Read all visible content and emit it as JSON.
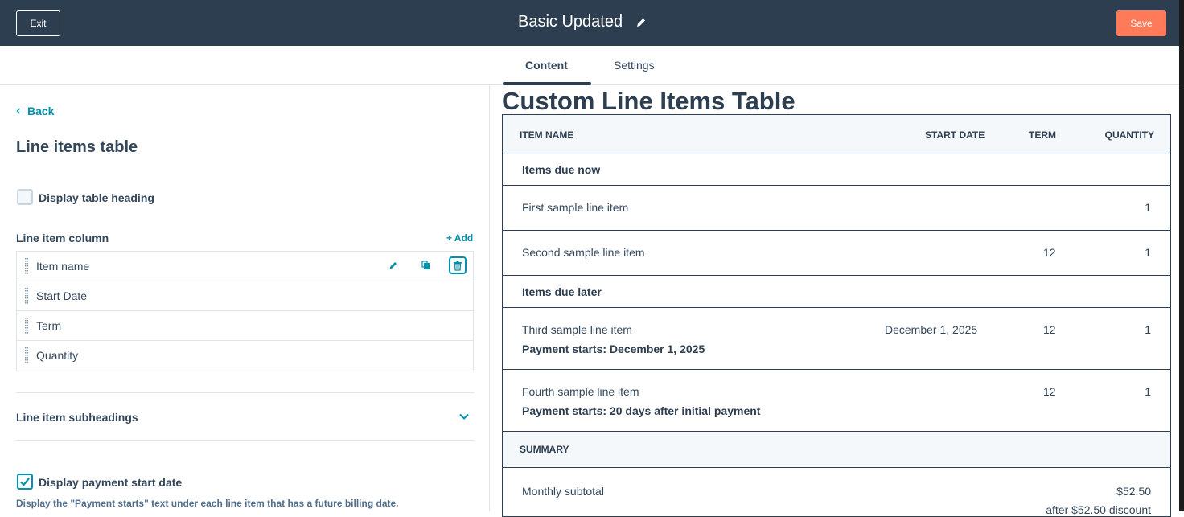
{
  "topbar": {
    "exit_label": "Exit",
    "title": "Basic Updated",
    "save_label": "Save",
    "colors": {
      "bg": "#2d3e50",
      "save": "#ff7a59"
    }
  },
  "tabs": {
    "content": "Content",
    "settings": "Settings"
  },
  "left": {
    "back": "Back",
    "title": "Line items table",
    "display_heading": "Display table heading",
    "column_section": "Line item column",
    "add": "+ Add",
    "columns": [
      "Item name",
      "Start Date",
      "Term",
      "Quantity"
    ],
    "subheadings": "Line item subheadings",
    "display_payment": "Display payment start date",
    "help": "Display the \"Payment starts\" text under each line item that has a future billing date."
  },
  "preview": {
    "title": "Custom Line Items Table",
    "headers": {
      "name": "ITEM NAME",
      "start": "START DATE",
      "term": "TERM",
      "qty": "QUANTITY"
    },
    "due_now": "Items due now",
    "due_later": "Items due later",
    "rows": [
      {
        "name": "First sample line item",
        "start": "",
        "term": "",
        "qty": "1",
        "sub": ""
      },
      {
        "name": "Second sample line item",
        "start": "",
        "term": "12",
        "qty": "1",
        "sub": ""
      },
      {
        "name": "Third sample line item",
        "start": "December 1, 2025",
        "term": "12",
        "qty": "1",
        "sub": "Payment starts: December 1, 2025"
      },
      {
        "name": "Fourth sample line item",
        "start": "",
        "term": "12",
        "qty": "1",
        "sub": "Payment starts: 20 days after initial payment"
      }
    ],
    "summary": "SUMMARY",
    "monthly_subtotal": "Monthly subtotal",
    "monthly_value": "$52.50",
    "discount_note": "after $52.50 discount"
  },
  "icons": {
    "pencil": "pencil-icon",
    "copy": "copy-icon",
    "trash": "trash-icon",
    "grip": "drag-handle-icon",
    "chevron": "chevron-down-icon"
  },
  "accent": "#0091ae"
}
